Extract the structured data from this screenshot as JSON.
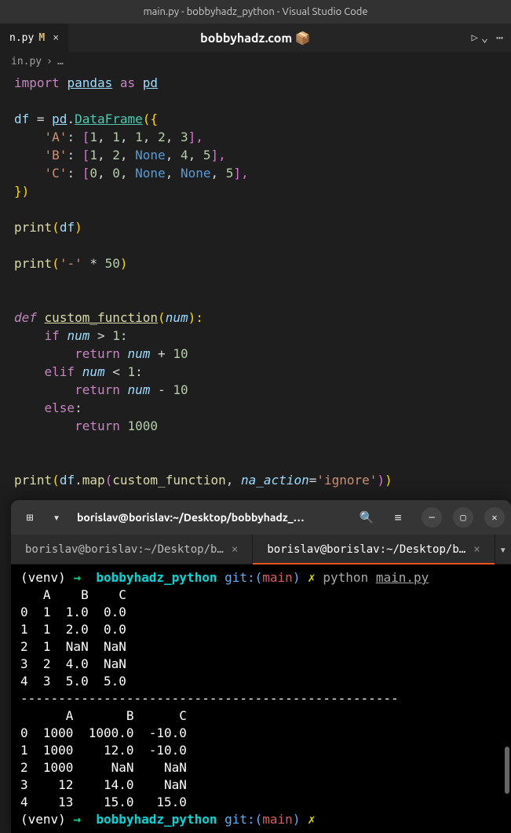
{
  "titlebar": "main.py - bobbyhadz_python - Visual Studio Code",
  "tab": {
    "name": "n.py",
    "modified": "M"
  },
  "center": "bobbyhadz.com 📦",
  "breadcrumb": {
    "file": "in.py",
    "sep": "›",
    "ell": "…"
  },
  "code": {
    "l1": {
      "import": "import",
      "pandas": "pandas",
      "as": "as",
      "pd": "pd"
    },
    "l2": {
      "df": "df",
      "eq": " = ",
      "pd": "pd",
      "dot": ".",
      "DataFrame": "DataFrame",
      "open": "({"
    },
    "l3": {
      "key": "'A'",
      "colon": ": ",
      "open": "[",
      "v1": "1",
      "v2": "1",
      "v3": "1",
      "v4": "2",
      "v5": "3",
      "close": "],",
      "c": ", "
    },
    "l4": {
      "key": "'B'",
      "colon": ": ",
      "open": "[",
      "v1": "1",
      "v2": "2",
      "none1": "None",
      "v4": "4",
      "v5": "5",
      "close": "],",
      "c": ", "
    },
    "l5": {
      "key": "'C'",
      "colon": ": ",
      "open": "[",
      "v1": "0",
      "v2": "0",
      "none1": "None",
      "none2": "None",
      "v5": "5",
      "close": "],",
      "c": ", "
    },
    "l6": {
      "close": "})"
    },
    "l7": {
      "print": "print",
      "open": "(",
      "df": "df",
      "close": ")"
    },
    "l8": {
      "print": "print",
      "open": "(",
      "str": "'-'",
      "mul": " * ",
      "n": "50",
      "close": ")"
    },
    "l9": {
      "def": "def",
      "name": "custom_function",
      "open": "(",
      "param": "num",
      "close": "):"
    },
    "l10": {
      "if": "if",
      "num": "num",
      "gt": " > ",
      "one": "1",
      "colon": ":"
    },
    "l11": {
      "return": "return",
      "num": "num",
      "plus": " + ",
      "ten": "10"
    },
    "l12": {
      "elif": "elif",
      "num": "num",
      "lt": " < ",
      "one": "1",
      "colon": ":"
    },
    "l13": {
      "return": "return",
      "num": "num",
      "minus": " - ",
      "ten": "10"
    },
    "l14": {
      "else": "else",
      "colon": ":"
    },
    "l15": {
      "return": "return",
      "thousand": "1000"
    },
    "l16": {
      "print": "print",
      "open": "(",
      "df": "df",
      "dot": ".",
      "map": "map",
      "open2": "(",
      "cf": "custom_function",
      "c": ", ",
      "na": "na_action",
      "eq": "=",
      "ignore": "'ignore'",
      "close2": ")",
      "close": ")"
    }
  },
  "terminal": {
    "title": "borislav@borislav:~/Desktop/bobbyhadz_…",
    "tab1": "borislav@borislav:~/Desktop/b…",
    "tab2": "borislav@borislav:~/Desktop/b…",
    "prompt1": {
      "venv": "(venv)",
      "arrow": "→",
      "path": "bobbyhadz_python",
      "git": "git:(",
      "branch": "main",
      "gitclose": ")",
      "light": "✗",
      "py": "python",
      "file": "main.py"
    },
    "out1": [
      "   A    B    C",
      "0  1  1.0  0.0",
      "1  1  2.0  0.0",
      "2  1  NaN  NaN",
      "3  2  4.0  NaN",
      "4  3  5.0  5.0",
      "--------------------------------------------------",
      "      A       B      C",
      "0  1000  1000.0  -10.0",
      "1  1000    12.0  -10.0",
      "2  1000     NaN    NaN",
      "3    12    14.0    NaN",
      "4    13    15.0   15.0"
    ],
    "prompt2": {
      "venv": "(venv)",
      "arrow": "→",
      "path": "bobbyhadz_python",
      "git": "git:(",
      "branch": "main",
      "gitclose": ")",
      "light": "✗"
    }
  }
}
